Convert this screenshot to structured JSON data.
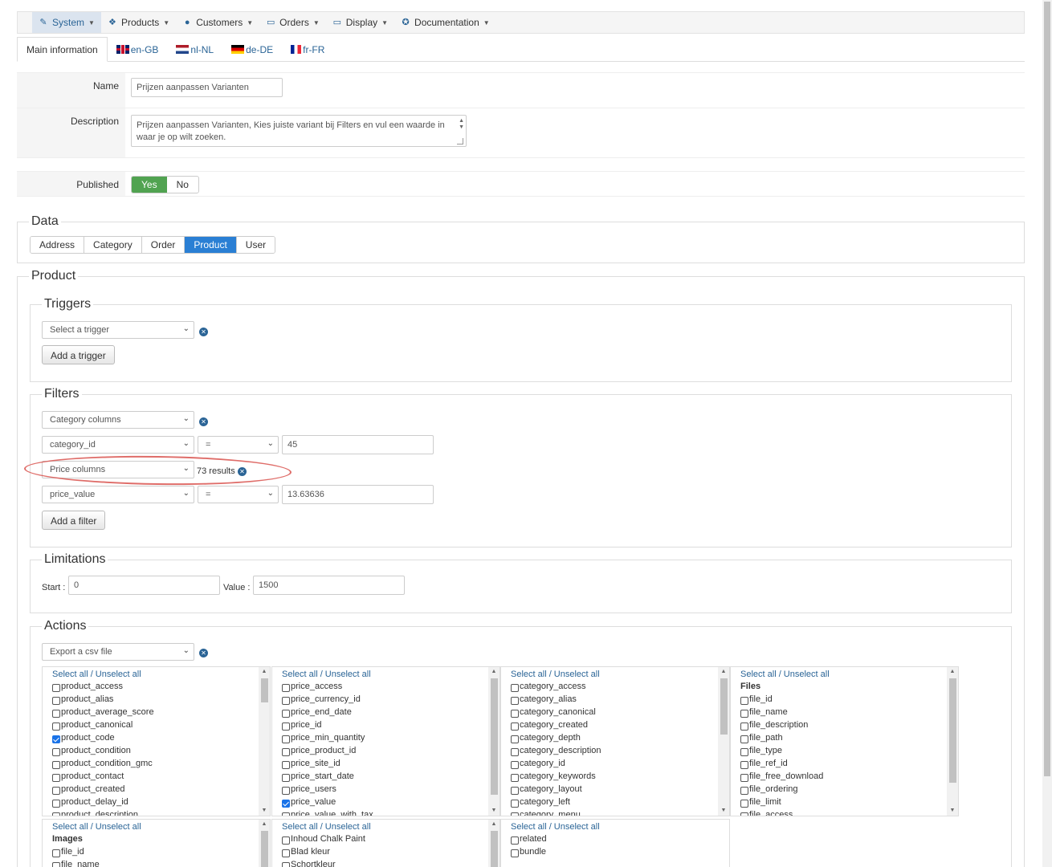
{
  "menu": [
    {
      "label": "System",
      "icon": "wrench-icon",
      "glyph": "✎",
      "active": true
    },
    {
      "label": "Products",
      "icon": "cubes-icon",
      "glyph": "❖",
      "active": false
    },
    {
      "label": "Customers",
      "icon": "user-icon",
      "glyph": "●",
      "active": false
    },
    {
      "label": "Orders",
      "icon": "credit-card-icon",
      "glyph": "▭",
      "active": false
    },
    {
      "label": "Display",
      "icon": "monitor-icon",
      "glyph": "▭",
      "active": false
    },
    {
      "label": "Documentation",
      "icon": "help-icon",
      "glyph": "✪",
      "active": false
    }
  ],
  "tabs": {
    "main": "Main information",
    "en": "en-GB",
    "nl": "nl-NL",
    "de": "de-DE",
    "fr": "fr-FR"
  },
  "form": {
    "name_label": "Name",
    "name_value": "Prijzen aanpassen Varianten",
    "description_label": "Description",
    "description_value": "Prijzen aanpassen Varianten, Kies juiste variant bij Filters en vul een waarde in waar je op wilt zoeken.",
    "published_label": "Published",
    "yes": "Yes",
    "no": "No"
  },
  "data_section": {
    "legend": "Data",
    "buttons": [
      "Address",
      "Category",
      "Order",
      "Product",
      "User"
    ],
    "active": "Product"
  },
  "product": {
    "legend": "Product",
    "triggers": {
      "legend": "Triggers",
      "select": "Select a trigger",
      "add": "Add a trigger"
    },
    "filters": {
      "legend": "Filters",
      "f1_group": "Category columns",
      "f1_column": "category_id",
      "f1_op": "=",
      "f1_value": "45",
      "f2_group": "Price columns",
      "f2_results": "73 results",
      "f2_column": "price_value",
      "f2_op": "=",
      "f2_value": "13.63636",
      "add": "Add a filter"
    },
    "limitations": {
      "legend": "Limitations",
      "start_label": "Start :",
      "start_value": "0",
      "value_label": "Value :",
      "value_value": "1500"
    },
    "actions": {
      "legend": "Actions",
      "select": "Export a csv file",
      "select_all": "Select all / Unselect all",
      "columns": [
        {
          "header": "",
          "items": [
            "product_access",
            "product_alias",
            "product_average_score",
            "product_canonical",
            "product_code",
            "product_condition",
            "product_condition_gmc",
            "product_contact",
            "product_created",
            "product_delay_id",
            "product_description"
          ],
          "checked": [
            "product_code"
          ]
        },
        {
          "header": "",
          "items": [
            "price_access",
            "price_currency_id",
            "price_end_date",
            "price_id",
            "price_min_quantity",
            "price_product_id",
            "price_site_id",
            "price_start_date",
            "price_users",
            "price_value",
            "price_value_with_tax"
          ],
          "checked": [
            "price_value"
          ]
        },
        {
          "header": "",
          "items": [
            "category_access",
            "category_alias",
            "category_canonical",
            "category_created",
            "category_depth",
            "category_description",
            "category_id",
            "category_keywords",
            "category_layout",
            "category_left",
            "category_menu"
          ],
          "checked": []
        },
        {
          "header": "Files",
          "items": [
            "file_id",
            "file_name",
            "file_description",
            "file_path",
            "file_type",
            "file_ref_id",
            "file_free_download",
            "file_ordering",
            "file_limit",
            "file_access"
          ],
          "checked": []
        },
        {
          "header": "Images",
          "items": [
            "file_id",
            "file_name"
          ],
          "checked": []
        },
        {
          "header": "",
          "items": [
            "Inhoud Chalk Paint",
            "Blad kleur",
            "Schortkleur"
          ],
          "checked": []
        },
        {
          "header": "",
          "items": [
            "related",
            "bundle"
          ],
          "checked": []
        }
      ]
    }
  }
}
